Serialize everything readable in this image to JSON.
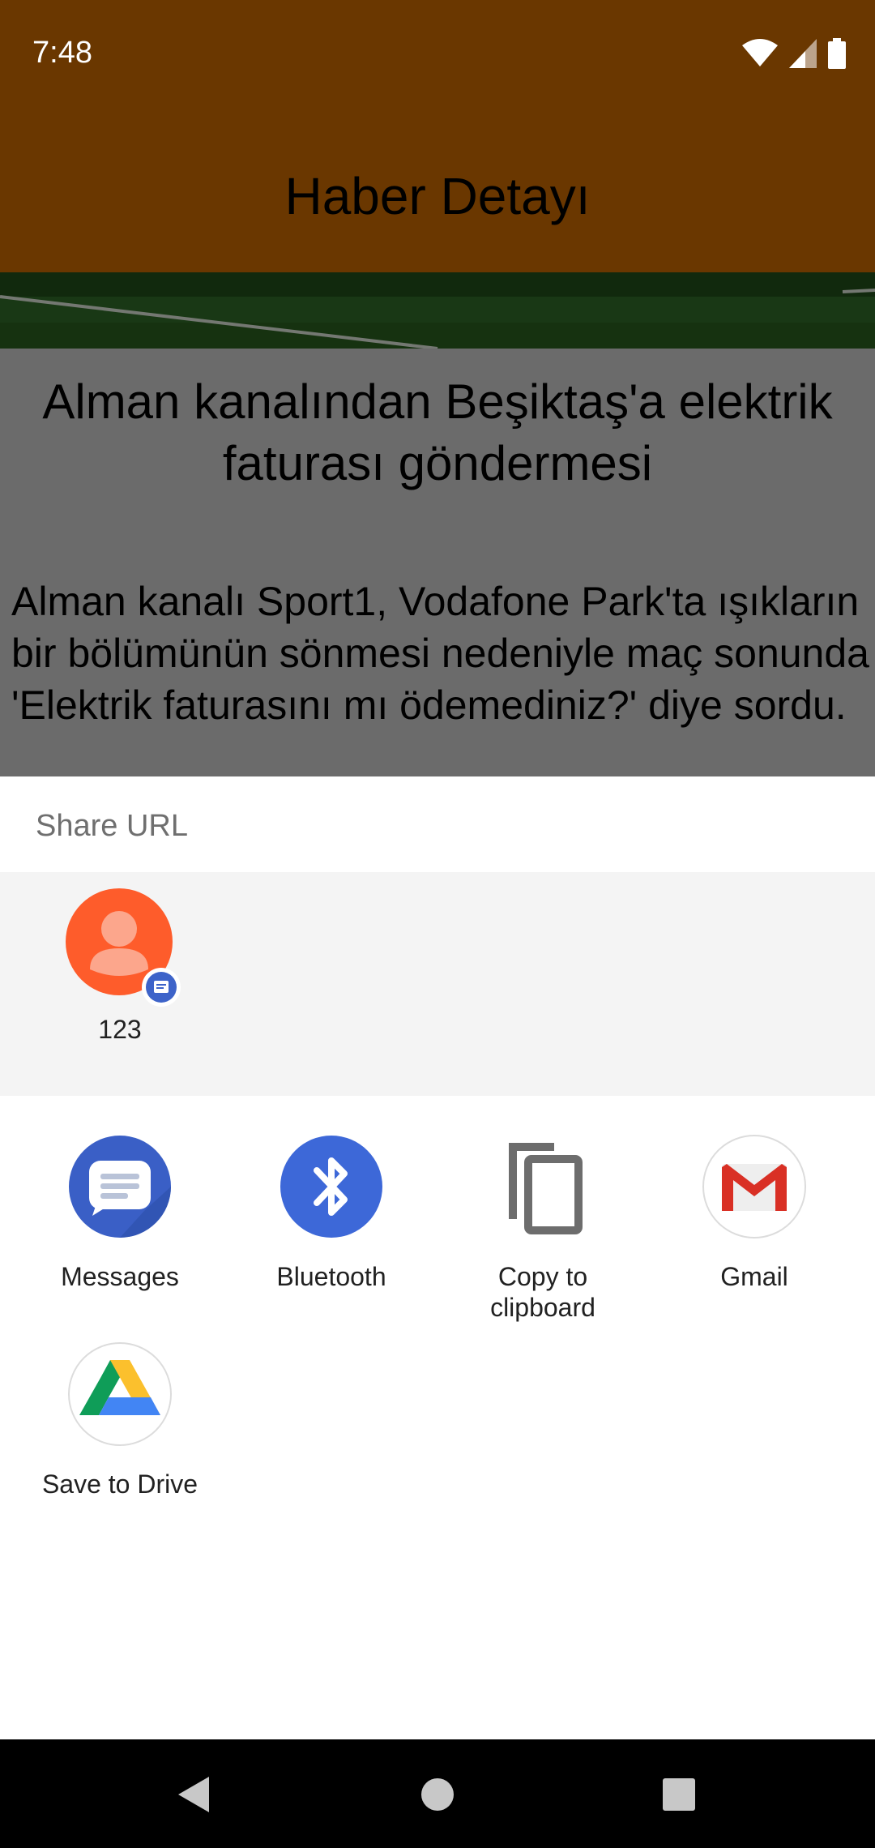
{
  "status_bar": {
    "time": "7:48"
  },
  "app": {
    "toolbar_title": "Haber Detayı",
    "article_title": "Alman kanalından Beşiktaş'a elektrik faturası göndermesi",
    "article_body": "Alman kanalı Sport1, Vodafone Park'ta ışıkların bir bölümünün sönmesi nedeniyle maç sonunda 'Elektrik faturasını mı ödemediniz?' diye sordu.",
    "accent_color": "#d46f00"
  },
  "share_sheet": {
    "title": "Share URL",
    "direct_share": [
      {
        "label": "123",
        "icon": "contact-avatar-icon"
      }
    ],
    "targets": [
      {
        "label": "Messages",
        "icon": "messages-icon"
      },
      {
        "label": "Bluetooth",
        "icon": "bluetooth-icon"
      },
      {
        "label_line1": "Copy to",
        "label_line2": "clipboard",
        "icon": "copy-icon"
      },
      {
        "label": "Gmail",
        "icon": "gmail-icon"
      },
      {
        "label": "Save to Drive",
        "icon": "drive-icon"
      }
    ]
  },
  "nav_bar": {
    "buttons": [
      "back",
      "home",
      "recents"
    ]
  }
}
